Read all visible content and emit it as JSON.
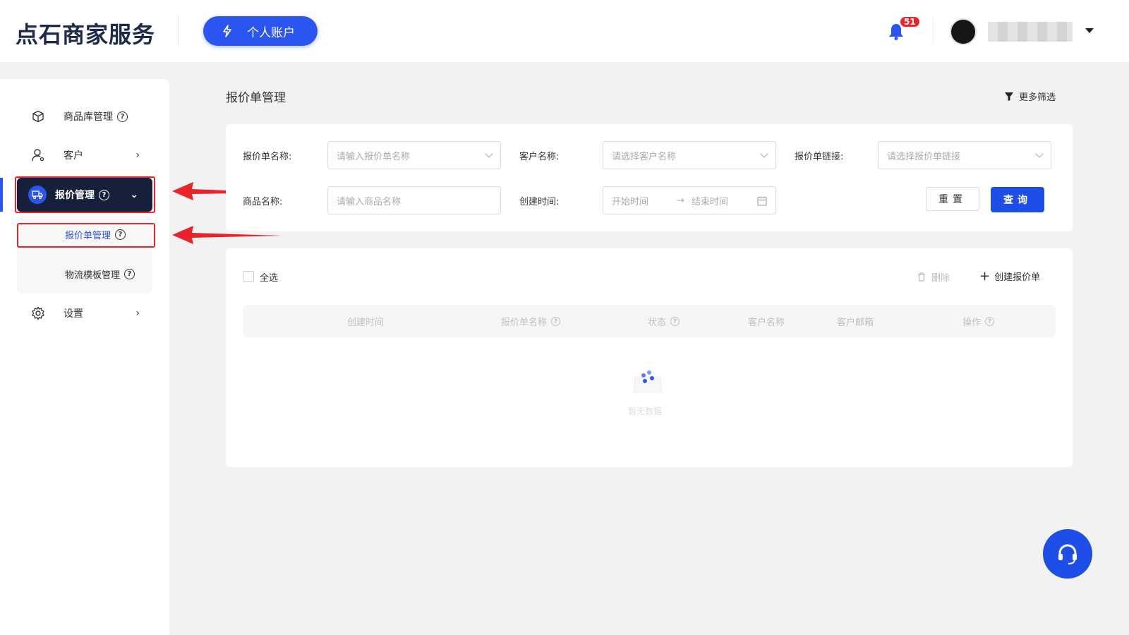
{
  "header": {
    "logo": "点石商家服务",
    "account_button": "个人账户",
    "notification_count": "51",
    "username": ""
  },
  "sidebar": {
    "items": [
      {
        "label": "商品库管理"
      },
      {
        "label": "客户"
      },
      {
        "label": "报价管理"
      },
      {
        "label": "设置"
      }
    ],
    "submenu": [
      {
        "label": "报价单管理"
      },
      {
        "label": "物流模板管理"
      }
    ],
    "help_glyph": "?"
  },
  "main": {
    "title": "报价单管理",
    "more_filter": "更多筛选",
    "filters": {
      "quote_name_label": "报价单名称:",
      "quote_name_placeholder": "请输入报价单名称",
      "customer_label": "客户名称:",
      "customer_placeholder": "请选择客户名称",
      "link_label": "报价单链接:",
      "link_placeholder": "请选择报价单链接",
      "product_label": "商品名称:",
      "product_placeholder": "请输入商品名称",
      "time_label": "创建时间:",
      "start_placeholder": "开始时间",
      "range_arrow": "→",
      "end_placeholder": "结束时间",
      "reset": "重置",
      "query": "查询"
    },
    "table": {
      "select_all": "全选",
      "delete": "删除",
      "create": "创建报价单",
      "columns": [
        "创建时间",
        "报价单名称",
        "状态",
        "客户名称",
        "客户邮箱",
        "操作"
      ],
      "empty_text": "暂无数据"
    }
  },
  "colors": {
    "accent": "#2a55f0",
    "sidebar_active": "#17203a",
    "annotation": "#e8242a"
  }
}
